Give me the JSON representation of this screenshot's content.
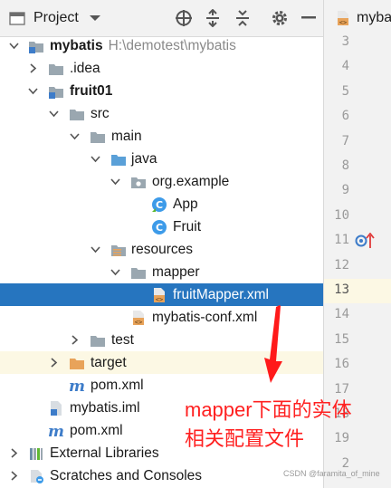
{
  "toolbar": {
    "title": "Project",
    "dropdown_icon": "chevron-down-icon",
    "icons": [
      "locate-target-icon",
      "expand-all-icon",
      "collapse-all-icon",
      "settings-gear-icon",
      "hide-minus-icon"
    ]
  },
  "editor": {
    "tab_label": "myba",
    "line_numbers": [
      "3",
      "4",
      "5",
      "6",
      "7",
      "8",
      "9",
      "10",
      "11",
      "12",
      "13",
      "14",
      "15",
      "16",
      "17",
      "18",
      "19",
      "2"
    ],
    "current_line": "13"
  },
  "tree": {
    "root_name": "mybatis",
    "root_path": "H:\\demotest\\mybatis",
    "idea": ".idea",
    "module": "fruit01",
    "src": "src",
    "main": "main",
    "java": "java",
    "package": "org.example",
    "class_app": "App",
    "class_fruit": "Fruit",
    "resources": "resources",
    "mapper": "mapper",
    "mapper_xml": "fruitMapper.xml",
    "conf_xml": "mybatis-conf.xml",
    "test": "test",
    "target": "target",
    "module_pom": "pom.xml",
    "root_iml": "mybatis.iml",
    "root_pom": "pom.xml",
    "external_libs": "External Libraries",
    "scratches": "Scratches and Consoles"
  },
  "annotation": {
    "line1": "mapper下面的实体",
    "line2": "相关配置文件",
    "color": "#ff2020"
  },
  "watermark": "CSDN @faramita_of_mine",
  "colors": {
    "selection": "#2675bf",
    "folder": "#9aa7b0",
    "source_folder": "#5aa0d8",
    "excluded_folder": "#e8a35a",
    "class_icon": "#3d9be9",
    "maven": "#3d7cc9"
  }
}
